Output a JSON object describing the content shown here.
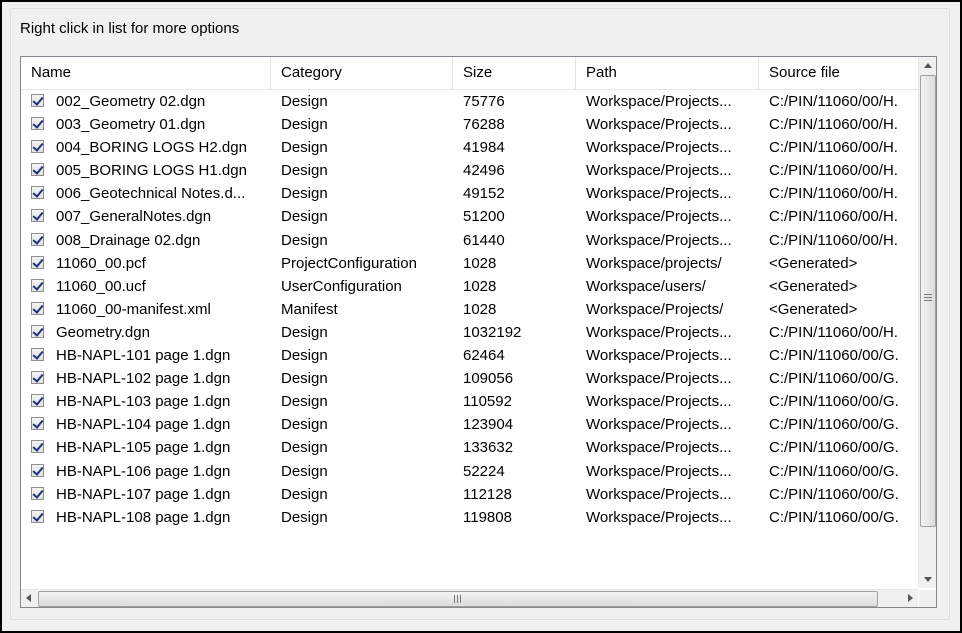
{
  "hint": "Right click in list for more options",
  "columns": [
    "Name",
    "Category",
    "Size",
    "Path",
    "Source file"
  ],
  "rows": [
    {
      "checked": true,
      "name": "002_Geometry 02.dgn",
      "category": "Design",
      "size": "75776",
      "path": "Workspace/Projects...",
      "source": "C:/PIN/11060/00/H."
    },
    {
      "checked": true,
      "name": "003_Geometry 01.dgn",
      "category": "Design",
      "size": "76288",
      "path": "Workspace/Projects...",
      "source": "C:/PIN/11060/00/H."
    },
    {
      "checked": true,
      "name": "004_BORING LOGS H2.dgn",
      "category": "Design",
      "size": "41984",
      "path": "Workspace/Projects...",
      "source": "C:/PIN/11060/00/H."
    },
    {
      "checked": true,
      "name": "005_BORING LOGS H1.dgn",
      "category": "Design",
      "size": "42496",
      "path": "Workspace/Projects...",
      "source": "C:/PIN/11060/00/H."
    },
    {
      "checked": true,
      "name": "006_Geotechnical Notes.d...",
      "category": "Design",
      "size": "49152",
      "path": "Workspace/Projects...",
      "source": "C:/PIN/11060/00/H."
    },
    {
      "checked": true,
      "name": "007_GeneralNotes.dgn",
      "category": "Design",
      "size": "51200",
      "path": "Workspace/Projects...",
      "source": "C:/PIN/11060/00/H."
    },
    {
      "checked": true,
      "name": "008_Drainage 02.dgn",
      "category": "Design",
      "size": "61440",
      "path": "Workspace/Projects...",
      "source": "C:/PIN/11060/00/H."
    },
    {
      "checked": true,
      "name": "11060_00.pcf",
      "category": "ProjectConfiguration",
      "size": "1028",
      "path": "Workspace/projects/",
      "source": "<Generated>"
    },
    {
      "checked": true,
      "name": "11060_00.ucf",
      "category": "UserConfiguration",
      "size": "1028",
      "path": "Workspace/users/",
      "source": "<Generated>"
    },
    {
      "checked": true,
      "name": "11060_00-manifest.xml",
      "category": "Manifest",
      "size": "1028",
      "path": "Workspace/Projects/",
      "source": "<Generated>"
    },
    {
      "checked": true,
      "name": "Geometry.dgn",
      "category": "Design",
      "size": "1032192",
      "path": "Workspace/Projects...",
      "source": "C:/PIN/11060/00/H."
    },
    {
      "checked": true,
      "name": "HB-NAPL-101 page 1.dgn",
      "category": "Design",
      "size": "62464",
      "path": "Workspace/Projects...",
      "source": "C:/PIN/11060/00/G."
    },
    {
      "checked": true,
      "name": "HB-NAPL-102 page 1.dgn",
      "category": "Design",
      "size": "109056",
      "path": "Workspace/Projects...",
      "source": "C:/PIN/11060/00/G."
    },
    {
      "checked": true,
      "name": "HB-NAPL-103 page 1.dgn",
      "category": "Design",
      "size": "110592",
      "path": "Workspace/Projects...",
      "source": "C:/PIN/11060/00/G."
    },
    {
      "checked": true,
      "name": "HB-NAPL-104 page 1.dgn",
      "category": "Design",
      "size": "123904",
      "path": "Workspace/Projects...",
      "source": "C:/PIN/11060/00/G."
    },
    {
      "checked": true,
      "name": "HB-NAPL-105 page 1.dgn",
      "category": "Design",
      "size": "133632",
      "path": "Workspace/Projects...",
      "source": "C:/PIN/11060/00/G."
    },
    {
      "checked": true,
      "name": "HB-NAPL-106 page 1.dgn",
      "category": "Design",
      "size": "52224",
      "path": "Workspace/Projects...",
      "source": "C:/PIN/11060/00/G."
    },
    {
      "checked": true,
      "name": "HB-NAPL-107 page 1.dgn",
      "category": "Design",
      "size": "112128",
      "path": "Workspace/Projects...",
      "source": "C:/PIN/11060/00/G."
    },
    {
      "checked": true,
      "name": "HB-NAPL-108 page 1.dgn",
      "category": "Design",
      "size": "119808",
      "path": "Workspace/Projects...",
      "source": "C:/PIN/11060/00/G."
    }
  ],
  "icons": {
    "scroll_up": "scroll-up-arrow-icon",
    "scroll_down": "scroll-down-arrow-icon",
    "scroll_left": "scroll-left-arrow-icon",
    "scroll_right": "scroll-right-arrow-icon"
  }
}
